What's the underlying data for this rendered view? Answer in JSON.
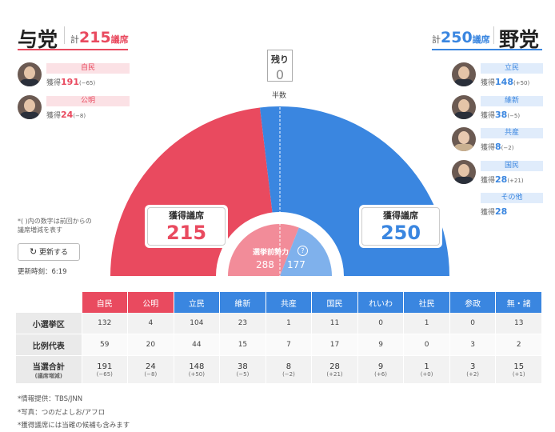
{
  "ruling": {
    "title": "与党",
    "total_prefix": "計",
    "total_value": "215",
    "total_suffix": "議席",
    "parties": [
      {
        "name": "自民",
        "seats_label": "獲得",
        "seats": "191",
        "diff": "(−65)"
      },
      {
        "name": "公明",
        "seats_label": "獲得",
        "seats": "24",
        "diff": "(−8)"
      }
    ]
  },
  "opposition": {
    "title": "野党",
    "total_prefix": "計",
    "total_value": "250",
    "total_suffix": "議席",
    "parties": [
      {
        "name": "立民",
        "seats_label": "獲得",
        "seats": "148",
        "diff": "(+50)"
      },
      {
        "name": "維新",
        "seats_label": "獲得",
        "seats": "38",
        "diff": "(−5)"
      },
      {
        "name": "共産",
        "seats_label": "獲得",
        "seats": "8",
        "diff": "(−2)"
      },
      {
        "name": "国民",
        "seats_label": "獲得",
        "seats": "28",
        "diff": "(+21)"
      },
      {
        "name": "その他",
        "seats_label": "獲得",
        "seats": "28",
        "diff": ""
      }
    ]
  },
  "remaining": {
    "label": "残り",
    "value": "0"
  },
  "majority_label": "半数",
  "seat_boxes": {
    "left": {
      "label": "獲得議席",
      "value": "215"
    },
    "right": {
      "label": "獲得議席",
      "value": "250"
    }
  },
  "pre_election": {
    "label": "選挙前勢力",
    "help_icon": "question-circle-icon",
    "ruling": "288",
    "opposition": "177"
  },
  "note": "*(  )内の数字は前回からの\n議席増減を表す",
  "update_button": {
    "icon": "refresh-icon",
    "label": "更新する"
  },
  "update_time": "更新時刻：6:19",
  "colors": {
    "ruling": "#e94a5f",
    "opposition": "#3a86e0",
    "ruling_light": "#f28c99",
    "opposition_light": "#7fb1ec"
  },
  "chart_data": {
    "type": "pie",
    "shape": "semicircle",
    "categories": [
      "与党",
      "野党"
    ],
    "values": [
      215,
      250
    ],
    "inner_values": [
      288,
      177
    ],
    "remaining": 0
  },
  "table": {
    "headers": [
      "自民",
      "公明",
      "立民",
      "維新",
      "共産",
      "国民",
      "れいわ",
      "社民",
      "参政",
      "無・諸"
    ],
    "header_colors": [
      "r",
      "r",
      "b",
      "b",
      "b",
      "b",
      "b",
      "b",
      "b",
      "b"
    ],
    "rows": [
      {
        "label": "小選挙区",
        "values": [
          "132",
          "4",
          "104",
          "23",
          "1",
          "11",
          "0",
          "1",
          "0",
          "13"
        ]
      },
      {
        "label": "比例代表",
        "values": [
          "59",
          "20",
          "44",
          "15",
          "7",
          "17",
          "9",
          "0",
          "3",
          "2"
        ]
      }
    ],
    "total": {
      "label": "当選合計",
      "sublabel": "(議席増減)",
      "values": [
        "191",
        "24",
        "148",
        "38",
        "8",
        "28",
        "9",
        "1",
        "3",
        "15"
      ],
      "diffs": [
        "(−65)",
        "(−8)",
        "(+50)",
        "(−5)",
        "(−2)",
        "(+21)",
        "(+6)",
        "(+0)",
        "(+2)",
        "(+1)"
      ]
    }
  },
  "footnotes": [
    "*情報提供：TBS/JNN",
    "*写真：つのだよしお/アフロ",
    "*獲得議席には当確の候補も含みます"
  ]
}
